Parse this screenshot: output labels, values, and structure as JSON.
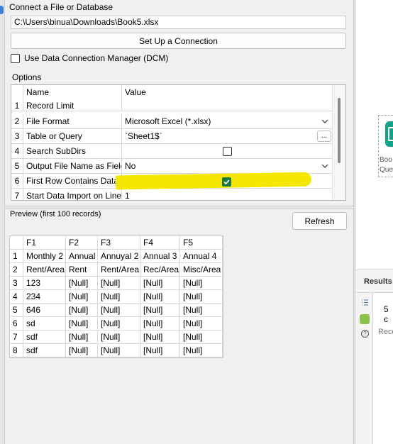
{
  "connect": {
    "title": "Connect a File or Database",
    "path": "C:\\Users\\binua\\Downloads\\Book5.xlsx",
    "setup_button": "Set Up a Connection",
    "dcm_label": "Use Data Connection Manager (DCM)",
    "dcm_checked": false
  },
  "options": {
    "title": "Options",
    "header": {
      "name": "Name",
      "value": "Value"
    },
    "rows": [
      {
        "num": "1",
        "name": "Record Limit",
        "value": ""
      },
      {
        "num": "2",
        "name": "File Format",
        "value": "Microsoft Excel (*.xlsx)"
      },
      {
        "num": "3",
        "name": "Table or Query",
        "value": "`Sheet1$`"
      },
      {
        "num": "4",
        "name": "Search SubDirs",
        "value": ""
      },
      {
        "num": "5",
        "name": "Output File Name as Field",
        "value": "No"
      },
      {
        "num": "6",
        "name": "First Row Contains Data",
        "value": ""
      },
      {
        "num": "7",
        "name": "Start Data Import on Line",
        "value": "1"
      }
    ],
    "ellipsis": "...",
    "search_subdirs_checked": false,
    "first_row_checked": true
  },
  "preview": {
    "title": "Preview (first 100 records)",
    "refresh_button": "Refresh",
    "columns": [
      "F1",
      "F2",
      "F3",
      "F4",
      "F5"
    ],
    "rows": [
      {
        "num": "1",
        "cells": [
          "Monthly 2",
          "Annual",
          "Annuyal 2",
          "Annual 3",
          "Annual 4"
        ]
      },
      {
        "num": "2",
        "cells": [
          "Rent/Area",
          "Rent",
          "Rent/Area",
          "Rec/Area",
          "Misc/Area"
        ]
      },
      {
        "num": "3",
        "cells": [
          "123",
          "[Null]",
          "[Null]",
          "[Null]",
          "[Null]"
        ]
      },
      {
        "num": "4",
        "cells": [
          "234",
          "[Null]",
          "[Null]",
          "[Null]",
          "[Null]"
        ]
      },
      {
        "num": "5",
        "cells": [
          "646",
          "[Null]",
          "[Null]",
          "[Null]",
          "[Null]"
        ]
      },
      {
        "num": "6",
        "cells": [
          "sd",
          "[Null]",
          "[Null]",
          "[Null]",
          "[Null]"
        ]
      },
      {
        "num": "7",
        "cells": [
          "sdf",
          "[Null]",
          "[Null]",
          "[Null]",
          "[Null]"
        ]
      },
      {
        "num": "8",
        "cells": [
          "sdf",
          "[Null]",
          "[Null]",
          "[Null]",
          "[Null]"
        ]
      }
    ]
  },
  "canvas": {
    "tool_label_1": "Boo",
    "tool_label_2": "Que"
  },
  "results": {
    "title": "Results",
    "count": "5 c",
    "record_label": "Reco"
  },
  "colors": {
    "highlight": "#f6e700",
    "check_green": "#1e7a3c",
    "tool_green": "#12a38a"
  }
}
